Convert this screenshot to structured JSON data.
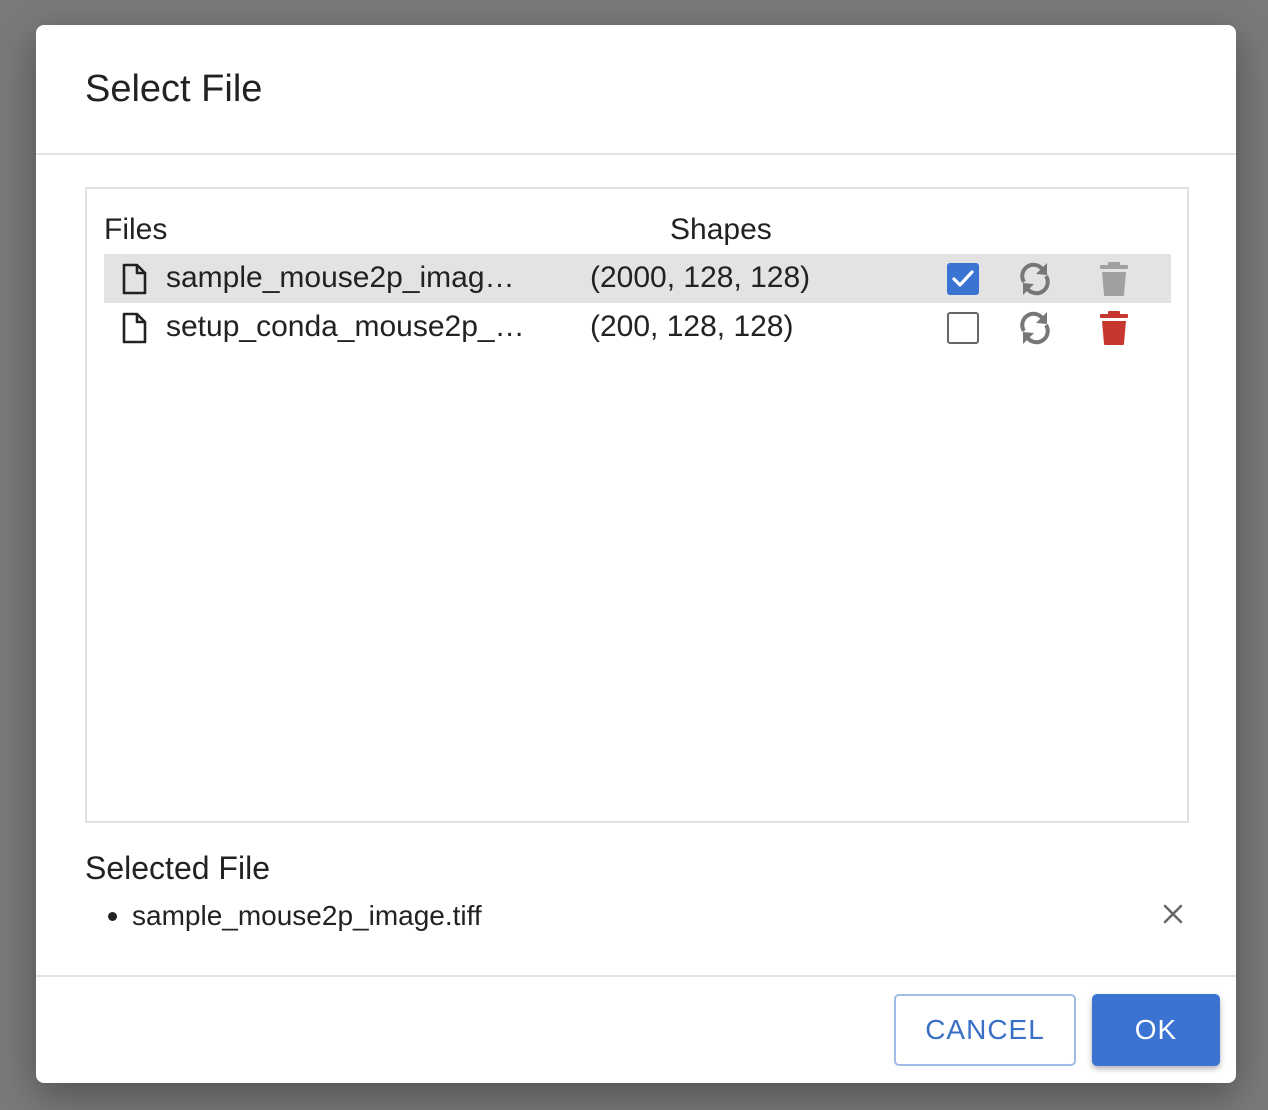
{
  "dialog": {
    "title": "Select File"
  },
  "table": {
    "headers": {
      "files": "Files",
      "shapes": "Shapes"
    },
    "rows": [
      {
        "name": "sample_mouse2p_imag…",
        "shape": "(2000, 128, 128)",
        "checked": true,
        "highlighted": true,
        "icon": "file-icon",
        "reload_icon": "reload-icon",
        "delete_icon": "trash-icon",
        "delete_color": "#a0a0a0"
      },
      {
        "name": "setup_conda_mouse2p_…",
        "shape": "(200, 128, 128)",
        "checked": false,
        "highlighted": false,
        "icon": "file-icon",
        "reload_icon": "reload-icon",
        "delete_icon": "trash-icon",
        "delete_color": "#c8372f"
      }
    ]
  },
  "selected": {
    "label": "Selected File",
    "items": [
      "sample_mouse2p_image.tiff"
    ],
    "remove_icon": "close-icon"
  },
  "actions": {
    "cancel_label": "CANCEL",
    "ok_label": "OK"
  },
  "colors": {
    "accent": "#3b73d3",
    "row_highlight": "#e3e3e3",
    "danger": "#c8372f",
    "disabled": "#a0a0a0"
  }
}
